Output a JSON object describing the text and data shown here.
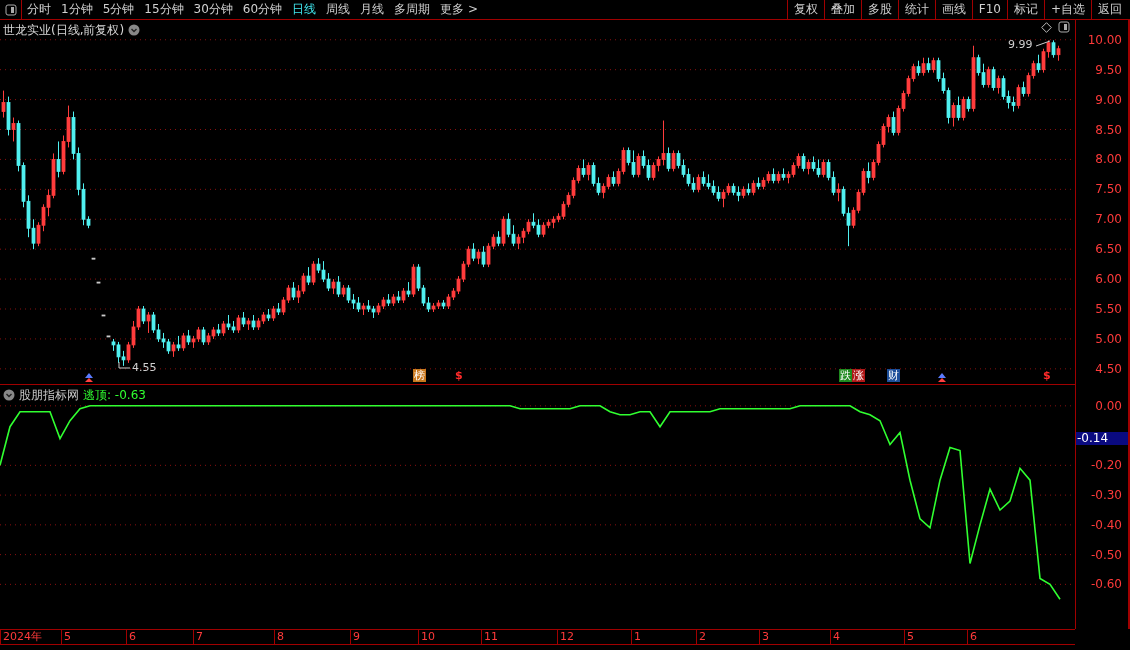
{
  "toolbar": {
    "periods": [
      {
        "label": "分时",
        "selected": false
      },
      {
        "label": "1分钟",
        "selected": false
      },
      {
        "label": "5分钟",
        "selected": false
      },
      {
        "label": "15分钟",
        "selected": false
      },
      {
        "label": "30分钟",
        "selected": false
      },
      {
        "label": "60分钟",
        "selected": false
      },
      {
        "label": "日线",
        "selected": true
      },
      {
        "label": "周线",
        "selected": false
      },
      {
        "label": "月线",
        "selected": false
      },
      {
        "label": "多周期",
        "selected": false
      },
      {
        "label": "更多 >",
        "selected": false
      }
    ],
    "buttons": [
      "复权",
      "叠加",
      "多股",
      "统计",
      "画线",
      "F10",
      "标记",
      "+自选",
      "返回"
    ]
  },
  "price_chart": {
    "title": "世龙实业(日线,前复权)",
    "annotations": [
      "4.55",
      "9.99"
    ],
    "tags": [
      {
        "label": "榜",
        "kind": "badge",
        "color": "#c8781e"
      },
      {
        "label": "$",
        "kind": "text",
        "color": "#ff2a2a"
      },
      {
        "label": "跌",
        "kind": "badge",
        "color": "#1f8a1f"
      },
      {
        "label": "涨",
        "kind": "badge",
        "color": "#b01818"
      },
      {
        "label": "财",
        "kind": "badge",
        "color": "#1d4f9a"
      },
      {
        "label": "$",
        "kind": "text",
        "color": "#ff2a2a"
      }
    ],
    "chart_data": {
      "type": "candlestick",
      "grid": true,
      "ylim": [
        4.23,
        10.33
      ],
      "yticks": [
        {
          "value": 10,
          "label": "10.00"
        },
        {
          "value": 9.5,
          "label": "9.50"
        },
        {
          "value": 9,
          "label": "9.00"
        },
        {
          "value": 8.5,
          "label": "8.50"
        },
        {
          "value": 8,
          "label": "8.00"
        },
        {
          "value": 7.5,
          "label": "7.50"
        },
        {
          "value": 7,
          "label": "7.00"
        },
        {
          "value": 6.5,
          "label": "6.50"
        },
        {
          "value": 6,
          "label": "6.00"
        },
        {
          "value": 5.5,
          "label": "5.50"
        },
        {
          "value": 5,
          "label": "5.00"
        },
        {
          "value": 4.5,
          "label": "4.50"
        }
      ],
      "categories": [
        null,
        null,
        null,
        null,
        null,
        null,
        null,
        null,
        null,
        null,
        null,
        null,
        null,
        null,
        null,
        null,
        null,
        null,
        null,
        null,
        null,
        null,
        null,
        null,
        null,
        null,
        null,
        null,
        null,
        null,
        null,
        null,
        null,
        null,
        null,
        null,
        null,
        null,
        null,
        null,
        null,
        null,
        null,
        null,
        null,
        null,
        null,
        null,
        null,
        null,
        null,
        null,
        null,
        null,
        null,
        null,
        null,
        null,
        null,
        null,
        null,
        null,
        null,
        null,
        null,
        null,
        null,
        null,
        null,
        null,
        null,
        null,
        null,
        null,
        null,
        null,
        null,
        null,
        null,
        null,
        null,
        null,
        null,
        null,
        null,
        null,
        null,
        null,
        null,
        null,
        null,
        null,
        null,
        null,
        null,
        null,
        null,
        null,
        null,
        null,
        null,
        null,
        null,
        null,
        null,
        null,
        null,
        null,
        null,
        null,
        null,
        null,
        null,
        null,
        null,
        null,
        null,
        null,
        null,
        null,
        null,
        null,
        null,
        null,
        null,
        null,
        null,
        null,
        null,
        null,
        null,
        null,
        null,
        null,
        null,
        null,
        null,
        null,
        null,
        null,
        null,
        null,
        null,
        null,
        null,
        null,
        null,
        null,
        null,
        null,
        null,
        null,
        null,
        null,
        null,
        null,
        null,
        null,
        null,
        null,
        null,
        null,
        null,
        null,
        null,
        null,
        null,
        null,
        null,
        null,
        null,
        null,
        null,
        null,
        null,
        null,
        null,
        null,
        null,
        null,
        null,
        null,
        null,
        null,
        null,
        null,
        null,
        null,
        null,
        null,
        null,
        null,
        null,
        null,
        null,
        null,
        null,
        null,
        null,
        null,
        null,
        null,
        null,
        null,
        null,
        null,
        null,
        null,
        null,
        null,
        null,
        null
      ],
      "ohlc": [
        [
          8.8,
          9.15,
          8.7,
          8.95
        ],
        [
          8.95,
          9.05,
          8.4,
          8.5
        ],
        [
          8.5,
          8.7,
          8.3,
          8.6
        ],
        [
          8.6,
          8.65,
          7.8,
          7.9
        ],
        [
          7.9,
          7.95,
          7.2,
          7.3
        ],
        [
          7.3,
          7.4,
          6.7,
          6.85
        ],
        [
          6.85,
          7.0,
          6.5,
          6.6
        ],
        [
          6.6,
          6.95,
          6.55,
          6.9
        ],
        [
          6.9,
          7.25,
          6.8,
          7.2
        ],
        [
          7.2,
          7.5,
          7.05,
          7.4
        ],
        [
          7.4,
          8.1,
          7.35,
          8.0
        ],
        [
          8.0,
          8.3,
          7.7,
          7.8
        ],
        [
          7.8,
          8.4,
          7.75,
          8.3
        ],
        [
          8.3,
          8.9,
          8.2,
          8.7
        ],
        [
          8.7,
          8.8,
          8.0,
          8.1
        ],
        [
          8.1,
          8.2,
          7.4,
          7.5
        ],
        [
          7.5,
          7.6,
          6.9,
          7.0
        ],
        [
          7.0,
          7.05,
          6.85,
          6.9
        ],
        [
          6.35,
          6.35,
          6.35,
          6.35
        ],
        [
          5.95,
          5.95,
          5.95,
          5.95
        ],
        [
          5.4,
          5.4,
          5.4,
          5.4
        ],
        [
          5.05,
          5.05,
          5.05,
          5.05
        ],
        [
          4.95,
          5.0,
          4.8,
          4.9
        ],
        [
          4.9,
          4.95,
          4.6,
          4.7
        ],
        [
          4.7,
          4.8,
          4.55,
          4.65
        ],
        [
          4.65,
          4.95,
          4.6,
          4.9
        ],
        [
          4.9,
          5.3,
          4.85,
          5.2
        ],
        [
          5.2,
          5.55,
          5.15,
          5.5
        ],
        [
          5.5,
          5.55,
          5.25,
          5.3
        ],
        [
          5.3,
          5.45,
          5.1,
          5.4
        ],
        [
          5.4,
          5.45,
          5.1,
          5.15
        ],
        [
          5.15,
          5.25,
          4.95,
          5.0
        ],
        [
          5.0,
          5.1,
          4.85,
          4.95
        ],
        [
          4.95,
          5.0,
          4.75,
          4.8
        ],
        [
          4.8,
          4.95,
          4.7,
          4.9
        ],
        [
          4.9,
          5.05,
          4.8,
          4.85
        ],
        [
          4.85,
          5.1,
          4.8,
          5.05
        ],
        [
          5.05,
          5.15,
          4.9,
          4.95
        ],
        [
          4.95,
          5.05,
          4.85,
          5.0
        ],
        [
          5.0,
          5.2,
          4.95,
          5.15
        ],
        [
          5.15,
          5.2,
          4.9,
          4.95
        ],
        [
          4.95,
          5.1,
          4.9,
          5.05
        ],
        [
          5.05,
          5.2,
          5.0,
          5.15
        ],
        [
          5.15,
          5.25,
          5.05,
          5.1
        ],
        [
          5.1,
          5.3,
          5.05,
          5.25
        ],
        [
          5.25,
          5.4,
          5.15,
          5.2
        ],
        [
          5.2,
          5.3,
          5.1,
          5.15
        ],
        [
          5.15,
          5.4,
          5.1,
          5.35
        ],
        [
          5.35,
          5.45,
          5.2,
          5.25
        ],
        [
          5.25,
          5.35,
          5.15,
          5.3
        ],
        [
          5.3,
          5.4,
          5.15,
          5.2
        ],
        [
          5.2,
          5.35,
          5.15,
          5.3
        ],
        [
          5.3,
          5.45,
          5.25,
          5.4
        ],
        [
          5.4,
          5.5,
          5.3,
          5.35
        ],
        [
          5.35,
          5.55,
          5.3,
          5.5
        ],
        [
          5.5,
          5.6,
          5.4,
          5.45
        ],
        [
          5.45,
          5.7,
          5.4,
          5.65
        ],
        [
          5.65,
          5.9,
          5.6,
          5.85
        ],
        [
          5.85,
          5.95,
          5.65,
          5.7
        ],
        [
          5.7,
          5.9,
          5.6,
          5.8
        ],
        [
          5.8,
          6.1,
          5.75,
          6.05
        ],
        [
          6.05,
          6.2,
          5.9,
          5.95
        ],
        [
          5.95,
          6.3,
          5.9,
          6.25
        ],
        [
          6.25,
          6.35,
          6.1,
          6.15
        ],
        [
          6.15,
          6.3,
          5.95,
          6.0
        ],
        [
          6.0,
          6.1,
          5.8,
          5.85
        ],
        [
          5.85,
          6.0,
          5.75,
          5.95
        ],
        [
          5.95,
          6.05,
          5.7,
          5.75
        ],
        [
          5.75,
          5.9,
          5.7,
          5.85
        ],
        [
          5.85,
          5.9,
          5.6,
          5.65
        ],
        [
          5.65,
          5.75,
          5.5,
          5.6
        ],
        [
          5.6,
          5.7,
          5.45,
          5.5
        ],
        [
          5.5,
          5.6,
          5.4,
          5.55
        ],
        [
          5.55,
          5.65,
          5.45,
          5.5
        ],
        [
          5.5,
          5.55,
          5.35,
          5.45
        ],
        [
          5.45,
          5.6,
          5.4,
          5.55
        ],
        [
          5.55,
          5.7,
          5.5,
          5.65
        ],
        [
          5.65,
          5.75,
          5.55,
          5.6
        ],
        [
          5.6,
          5.75,
          5.55,
          5.7
        ],
        [
          5.7,
          5.8,
          5.6,
          5.65
        ],
        [
          5.65,
          5.85,
          5.6,
          5.8
        ],
        [
          5.8,
          5.95,
          5.7,
          5.75
        ],
        [
          5.75,
          6.25,
          5.7,
          6.2
        ],
        [
          6.2,
          6.25,
          5.8,
          5.85
        ],
        [
          5.85,
          5.9,
          5.55,
          5.6
        ],
        [
          5.6,
          5.7,
          5.45,
          5.5
        ],
        [
          5.5,
          5.6,
          5.45,
          5.55
        ],
        [
          5.55,
          5.65,
          5.5,
          5.6
        ],
        [
          5.6,
          5.65,
          5.5,
          5.55
        ],
        [
          5.55,
          5.75,
          5.5,
          5.7
        ],
        [
          5.7,
          5.85,
          5.65,
          5.8
        ],
        [
          5.8,
          6.05,
          5.75,
          6.0
        ],
        [
          6.0,
          6.3,
          5.95,
          6.25
        ],
        [
          6.25,
          6.55,
          6.2,
          6.5
        ],
        [
          6.5,
          6.6,
          6.3,
          6.35
        ],
        [
          6.35,
          6.5,
          6.25,
          6.45
        ],
        [
          6.45,
          6.55,
          6.2,
          6.25
        ],
        [
          6.25,
          6.6,
          6.2,
          6.55
        ],
        [
          6.55,
          6.75,
          6.5,
          6.7
        ],
        [
          6.7,
          6.8,
          6.55,
          6.6
        ],
        [
          6.6,
          7.05,
          6.55,
          7.0
        ],
        [
          7.0,
          7.1,
          6.7,
          6.75
        ],
        [
          6.75,
          6.9,
          6.55,
          6.6
        ],
        [
          6.6,
          6.75,
          6.5,
          6.7
        ],
        [
          6.7,
          6.85,
          6.6,
          6.8
        ],
        [
          6.8,
          7.0,
          6.75,
          6.95
        ],
        [
          6.95,
          7.1,
          6.85,
          6.9
        ],
        [
          6.9,
          7.0,
          6.7,
          6.75
        ],
        [
          6.75,
          6.95,
          6.7,
          6.9
        ],
        [
          6.9,
          7.0,
          6.85,
          6.95
        ],
        [
          6.95,
          7.05,
          6.85,
          7.0
        ],
        [
          7.0,
          7.1,
          6.95,
          7.05
        ],
        [
          7.05,
          7.3,
          7.0,
          7.25
        ],
        [
          7.25,
          7.45,
          7.2,
          7.4
        ],
        [
          7.4,
          7.7,
          7.35,
          7.65
        ],
        [
          7.65,
          7.9,
          7.6,
          7.85
        ],
        [
          7.85,
          8.0,
          7.7,
          7.75
        ],
        [
          7.75,
          7.95,
          7.65,
          7.9
        ],
        [
          7.9,
          7.95,
          7.55,
          7.6
        ],
        [
          7.6,
          7.7,
          7.4,
          7.45
        ],
        [
          7.45,
          7.6,
          7.35,
          7.55
        ],
        [
          7.55,
          7.75,
          7.5,
          7.7
        ],
        [
          7.7,
          7.8,
          7.55,
          7.6
        ],
        [
          7.6,
          7.85,
          7.55,
          7.8
        ],
        [
          7.8,
          8.2,
          7.75,
          8.15
        ],
        [
          8.15,
          8.2,
          7.9,
          7.95
        ],
        [
          7.95,
          8.15,
          7.7,
          7.75
        ],
        [
          7.75,
          8.1,
          7.7,
          8.05
        ],
        [
          8.05,
          8.15,
          7.85,
          7.9
        ],
        [
          7.9,
          8.0,
          7.65,
          7.7
        ],
        [
          7.7,
          7.95,
          7.65,
          7.9
        ],
        [
          7.9,
          8.05,
          7.8,
          8.0
        ],
        [
          8.0,
          8.65,
          7.9,
          8.1
        ],
        [
          8.1,
          8.2,
          7.8,
          7.85
        ],
        [
          7.85,
          8.15,
          7.8,
          8.1
        ],
        [
          8.1,
          8.15,
          7.85,
          7.9
        ],
        [
          7.9,
          8.0,
          7.7,
          7.75
        ],
        [
          7.75,
          7.85,
          7.55,
          7.6
        ],
        [
          7.6,
          7.7,
          7.45,
          7.5
        ],
        [
          7.5,
          7.75,
          7.45,
          7.7
        ],
        [
          7.7,
          7.8,
          7.55,
          7.6
        ],
        [
          7.6,
          7.75,
          7.5,
          7.55
        ],
        [
          7.55,
          7.65,
          7.4,
          7.45
        ],
        [
          7.45,
          7.55,
          7.3,
          7.35
        ],
        [
          7.35,
          7.5,
          7.2,
          7.45
        ],
        [
          7.45,
          7.6,
          7.4,
          7.55
        ],
        [
          7.55,
          7.6,
          7.4,
          7.45
        ],
        [
          7.45,
          7.55,
          7.3,
          7.4
        ],
        [
          7.4,
          7.55,
          7.35,
          7.5
        ],
        [
          7.5,
          7.6,
          7.4,
          7.45
        ],
        [
          7.45,
          7.65,
          7.4,
          7.6
        ],
        [
          7.6,
          7.7,
          7.5,
          7.55
        ],
        [
          7.55,
          7.7,
          7.5,
          7.65
        ],
        [
          7.65,
          7.8,
          7.6,
          7.75
        ],
        [
          7.75,
          7.85,
          7.6,
          7.65
        ],
        [
          7.65,
          7.8,
          7.6,
          7.75
        ],
        [
          7.75,
          7.85,
          7.65,
          7.7
        ],
        [
          7.7,
          7.8,
          7.6,
          7.75
        ],
        [
          7.75,
          7.95,
          7.7,
          7.9
        ],
        [
          7.9,
          8.1,
          7.85,
          8.05
        ],
        [
          8.05,
          8.1,
          7.8,
          7.85
        ],
        [
          7.85,
          8.0,
          7.75,
          7.95
        ],
        [
          7.95,
          8.05,
          7.8,
          7.85
        ],
        [
          7.85,
          8.0,
          7.7,
          7.75
        ],
        [
          7.75,
          8.0,
          7.7,
          7.95
        ],
        [
          7.95,
          8.0,
          7.65,
          7.7
        ],
        [
          7.7,
          7.8,
          7.4,
          7.45
        ],
        [
          7.45,
          7.6,
          7.3,
          7.5
        ],
        [
          7.5,
          7.55,
          7.05,
          7.1
        ],
        [
          7.1,
          7.2,
          6.55,
          6.9
        ],
        [
          6.9,
          7.2,
          6.85,
          7.15
        ],
        [
          7.15,
          7.5,
          7.1,
          7.45
        ],
        [
          7.45,
          7.85,
          7.4,
          7.8
        ],
        [
          7.8,
          7.95,
          7.6,
          7.7
        ],
        [
          7.7,
          8.0,
          7.65,
          7.95
        ],
        [
          7.95,
          8.3,
          7.9,
          8.25
        ],
        [
          8.25,
          8.6,
          8.2,
          8.55
        ],
        [
          8.55,
          8.75,
          8.45,
          8.7
        ],
        [
          8.7,
          8.8,
          8.4,
          8.45
        ],
        [
          8.45,
          8.9,
          8.4,
          8.85
        ],
        [
          8.85,
          9.15,
          8.8,
          9.1
        ],
        [
          9.1,
          9.4,
          9.05,
          9.35
        ],
        [
          9.35,
          9.6,
          9.3,
          9.55
        ],
        [
          9.55,
          9.65,
          9.4,
          9.45
        ],
        [
          9.45,
          9.7,
          9.4,
          9.6
        ],
        [
          9.6,
          9.7,
          9.45,
          9.5
        ],
        [
          9.5,
          9.7,
          9.45,
          9.65
        ],
        [
          9.65,
          9.7,
          9.3,
          9.35
        ],
        [
          9.35,
          9.45,
          9.1,
          9.15
        ],
        [
          9.15,
          9.2,
          8.6,
          8.7
        ],
        [
          8.7,
          8.95,
          8.55,
          8.9
        ],
        [
          8.9,
          9.05,
          8.65,
          8.7
        ],
        [
          8.7,
          9.05,
          8.65,
          9.0
        ],
        [
          9.0,
          9.05,
          8.8,
          8.85
        ],
        [
          8.85,
          9.9,
          8.8,
          9.7
        ],
        [
          9.7,
          9.75,
          9.4,
          9.45
        ],
        [
          9.45,
          9.6,
          9.2,
          9.25
        ],
        [
          9.25,
          9.55,
          9.2,
          9.5
        ],
        [
          9.5,
          9.55,
          9.15,
          9.2
        ],
        [
          9.2,
          9.4,
          9.1,
          9.35
        ],
        [
          9.35,
          9.4,
          9.0,
          9.05
        ],
        [
          9.05,
          9.15,
          8.85,
          8.95
        ],
        [
          8.95,
          9.05,
          8.8,
          8.9
        ],
        [
          8.9,
          9.25,
          8.85,
          9.2
        ],
        [
          9.2,
          9.3,
          9.05,
          9.1
        ],
        [
          9.1,
          9.45,
          9.05,
          9.4
        ],
        [
          9.4,
          9.65,
          9.35,
          9.6
        ],
        [
          9.6,
          9.75,
          9.45,
          9.5
        ],
        [
          9.5,
          9.85,
          9.45,
          9.8
        ],
        [
          9.8,
          9.99,
          9.7,
          9.95
        ],
        [
          9.95,
          9.99,
          9.7,
          9.75
        ],
        [
          9.75,
          9.9,
          9.65,
          9.85
        ]
      ]
    }
  },
  "indicator": {
    "name": "股朋指标网",
    "value_label": "逃顶: -0.63",
    "current": "-0.14",
    "chart_data": {
      "type": "line",
      "grid": true,
      "ylim": [
        -0.75,
        0.07
      ],
      "yticks": [
        {
          "value": 0,
          "label": "0.00"
        },
        {
          "value": -0.2,
          "label": "-0.20"
        },
        {
          "value": -0.3,
          "label": "-0.30"
        },
        {
          "value": -0.4,
          "label": "-0.40"
        },
        {
          "value": -0.5,
          "label": "-0.50"
        },
        {
          "value": -0.6,
          "label": "-0.60"
        }
      ],
      "categories": [
        null,
        null,
        null,
        null,
        null,
        null,
        null,
        null,
        null,
        null,
        null,
        null,
        null,
        null,
        null,
        null,
        null,
        null,
        null,
        null,
        null,
        null,
        null,
        null,
        null,
        null,
        null,
        null,
        null,
        null,
        null,
        null,
        null,
        null,
        null,
        null,
        null,
        null,
        null,
        null,
        null,
        null,
        null,
        null,
        null,
        null,
        null,
        null,
        null,
        null,
        null,
        null,
        null,
        null,
        null,
        null,
        null,
        null,
        null,
        null,
        null,
        null,
        null,
        null,
        null,
        null,
        null,
        null,
        null,
        null,
        null,
        null,
        null,
        null,
        null,
        null,
        null,
        null,
        null,
        null,
        null,
        null,
        null,
        null,
        null,
        null,
        null,
        null,
        null,
        null,
        null,
        null,
        null,
        null,
        null,
        null,
        null,
        null,
        null,
        null,
        null,
        null,
        null,
        null,
        null,
        null,
        null
      ],
      "series": [
        {
          "color": "#30ff30",
          "values": [
            -0.2,
            -0.07,
            -0.02,
            -0.02,
            -0.02,
            -0.02,
            -0.11,
            -0.05,
            -0.01,
            0,
            0,
            0,
            0,
            0,
            0,
            0,
            0,
            0,
            0,
            0,
            0,
            0,
            0,
            0,
            0,
            0,
            0,
            0,
            0,
            0,
            0,
            0,
            0,
            0,
            0,
            0,
            0,
            0,
            0,
            0,
            0,
            0,
            0,
            0,
            0,
            0,
            0,
            0,
            0,
            0,
            0,
            0,
            -0.01,
            -0.01,
            -0.01,
            -0.01,
            -0.01,
            -0.01,
            0,
            0,
            0,
            -0.02,
            -0.03,
            -0.03,
            -0.02,
            -0.02,
            -0.07,
            -0.02,
            -0.02,
            -0.02,
            -0.02,
            -0.02,
            -0.01,
            -0.01,
            -0.01,
            -0.01,
            -0.01,
            -0.01,
            -0.01,
            -0.01,
            0,
            0,
            0,
            0,
            0,
            0,
            -0.02,
            -0.03,
            -0.05,
            -0.13,
            -0.09,
            -0.25,
            -0.38,
            -0.41,
            -0.25,
            -0.14,
            -0.15,
            -0.53,
            -0.4,
            -0.28,
            -0.35,
            -0.32,
            -0.21,
            -0.25,
            -0.58,
            -0.6,
            -0.65
          ]
        }
      ]
    }
  },
  "time_axis": [
    "2024年",
    "5",
    "6",
    "7",
    "8",
    "9",
    "10",
    "11",
    "12",
    "1",
    "2",
    "3",
    "4",
    "5",
    "6"
  ]
}
